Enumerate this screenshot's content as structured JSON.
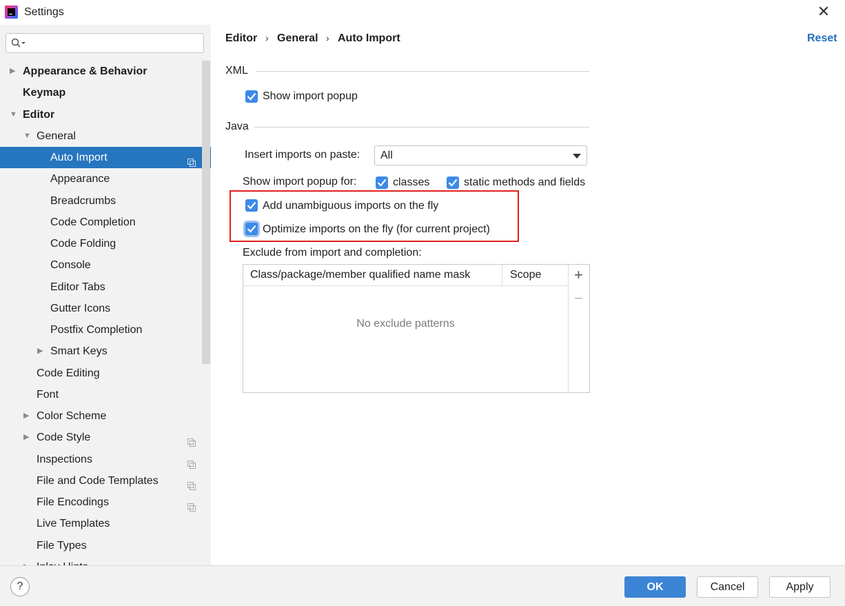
{
  "window": {
    "title": "Settings"
  },
  "search": {
    "placeholder": ""
  },
  "sidebar": {
    "items": [
      {
        "label": "Appearance & Behavior",
        "bold": true,
        "arrow": "right",
        "indent": 0
      },
      {
        "label": "Keymap",
        "bold": true,
        "arrow": "none",
        "indent": 0
      },
      {
        "label": "Editor",
        "bold": true,
        "arrow": "down",
        "indent": 0
      },
      {
        "label": "General",
        "bold": false,
        "arrow": "down",
        "indent": 1
      },
      {
        "label": "Auto Import",
        "bold": false,
        "arrow": "none",
        "indent": 2,
        "selected": true,
        "project": true
      },
      {
        "label": "Appearance",
        "bold": false,
        "arrow": "none",
        "indent": 2
      },
      {
        "label": "Breadcrumbs",
        "bold": false,
        "arrow": "none",
        "indent": 2
      },
      {
        "label": "Code Completion",
        "bold": false,
        "arrow": "none",
        "indent": 2
      },
      {
        "label": "Code Folding",
        "bold": false,
        "arrow": "none",
        "indent": 2
      },
      {
        "label": "Console",
        "bold": false,
        "arrow": "none",
        "indent": 2
      },
      {
        "label": "Editor Tabs",
        "bold": false,
        "arrow": "none",
        "indent": 2
      },
      {
        "label": "Gutter Icons",
        "bold": false,
        "arrow": "none",
        "indent": 2
      },
      {
        "label": "Postfix Completion",
        "bold": false,
        "arrow": "none",
        "indent": 2
      },
      {
        "label": "Smart Keys",
        "bold": false,
        "arrow": "right",
        "indent": 2
      },
      {
        "label": "Code Editing",
        "bold": false,
        "arrow": "none",
        "indent": 1
      },
      {
        "label": "Font",
        "bold": false,
        "arrow": "none",
        "indent": 1
      },
      {
        "label": "Color Scheme",
        "bold": false,
        "arrow": "right",
        "indent": 1
      },
      {
        "label": "Code Style",
        "bold": false,
        "arrow": "right",
        "indent": 1,
        "project": true
      },
      {
        "label": "Inspections",
        "bold": false,
        "arrow": "none",
        "indent": 1,
        "project": true
      },
      {
        "label": "File and Code Templates",
        "bold": false,
        "arrow": "none",
        "indent": 1,
        "project": true
      },
      {
        "label": "File Encodings",
        "bold": false,
        "arrow": "none",
        "indent": 1,
        "project": true
      },
      {
        "label": "Live Templates",
        "bold": false,
        "arrow": "none",
        "indent": 1
      },
      {
        "label": "File Types",
        "bold": false,
        "arrow": "none",
        "indent": 1
      },
      {
        "label": "Inlay Hints",
        "bold": false,
        "arrow": "right",
        "indent": 1,
        "project": true
      }
    ]
  },
  "breadcrumb": {
    "items": [
      "Editor",
      "General",
      "Auto Import"
    ],
    "separator": "›"
  },
  "reset_label": "Reset",
  "xml": {
    "title": "XML",
    "show_import_popup": {
      "label": "Show import popup",
      "checked": true
    }
  },
  "java": {
    "title": "Java",
    "insert_imports_label": "Insert imports on paste:",
    "insert_imports_value": "All",
    "show_popup_for_label": "Show import popup for:",
    "classes": {
      "label": "classes",
      "checked": true
    },
    "static_methods": {
      "label": "static methods and fields",
      "checked": true
    },
    "add_unambiguous": {
      "label": "Add unambiguous imports on the fly",
      "checked": true
    },
    "optimize_imports": {
      "label": "Optimize imports on the fly (for current project)",
      "checked": true
    },
    "exclude_label": "Exclude from import and completion:",
    "table": {
      "columns": [
        "Class/package/member qualified name mask",
        "Scope"
      ],
      "empty_text": "No exclude patterns",
      "add_icon": "+",
      "remove_icon": "−"
    }
  },
  "footer": {
    "help_label": "?",
    "ok_label": "OK",
    "cancel_label": "Cancel",
    "apply_label": "Apply"
  },
  "colors": {
    "accent": "#3c85d6",
    "selection": "#2675bf",
    "checkbox": "#3d8ae8",
    "highlight_border": "#e0201f",
    "link": "#2670c0"
  }
}
